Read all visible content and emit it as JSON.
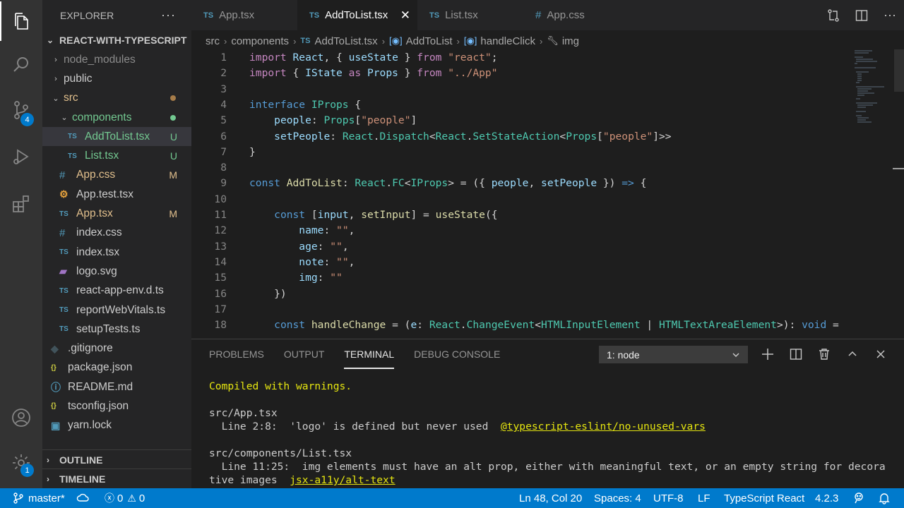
{
  "explorer": {
    "title": "EXPLORER",
    "project": "REACT-WITH-TYPESCRIPT",
    "tree": [
      {
        "label": "node_modules",
        "kind": "folder",
        "expanded": false,
        "depth": 1,
        "color": "#8b8b8b"
      },
      {
        "label": "public",
        "kind": "folder",
        "expanded": false,
        "depth": 1,
        "color": "#cccccc"
      },
      {
        "label": "src",
        "kind": "folder",
        "expanded": true,
        "depth": 1,
        "color": "#e2c08d",
        "dot": "#a67c49"
      },
      {
        "label": "components",
        "kind": "folder",
        "expanded": true,
        "depth": 2,
        "color": "#73c991",
        "dot": "#73c991"
      },
      {
        "label": "AddToList.tsx",
        "kind": "ts",
        "depth": 3,
        "color": "#73c991",
        "status": "U",
        "selected": true
      },
      {
        "label": "List.tsx",
        "kind": "ts",
        "depth": 3,
        "color": "#73c991",
        "status": "U"
      },
      {
        "label": "App.css",
        "kind": "css",
        "depth": 2,
        "color": "#e2c08d",
        "status": "M"
      },
      {
        "label": "App.test.tsx",
        "kind": "test",
        "depth": 2,
        "color": "#cccccc"
      },
      {
        "label": "App.tsx",
        "kind": "ts",
        "depth": 2,
        "color": "#e2c08d",
        "status": "M"
      },
      {
        "label": "index.css",
        "kind": "css",
        "depth": 2,
        "color": "#cccccc"
      },
      {
        "label": "index.tsx",
        "kind": "ts",
        "depth": 2,
        "color": "#cccccc"
      },
      {
        "label": "logo.svg",
        "kind": "svg",
        "depth": 2,
        "color": "#cccccc"
      },
      {
        "label": "react-app-env.d.ts",
        "kind": "ts",
        "depth": 2,
        "color": "#cccccc"
      },
      {
        "label": "reportWebVitals.ts",
        "kind": "ts",
        "depth": 2,
        "color": "#cccccc"
      },
      {
        "label": "setupTests.ts",
        "kind": "ts",
        "depth": 2,
        "color": "#cccccc"
      },
      {
        "label": ".gitignore",
        "kind": "git",
        "depth": 1,
        "color": "#cccccc"
      },
      {
        "label": "package.json",
        "kind": "json",
        "depth": 1,
        "color": "#cccccc"
      },
      {
        "label": "README.md",
        "kind": "info",
        "depth": 1,
        "color": "#cccccc"
      },
      {
        "label": "tsconfig.json",
        "kind": "json",
        "depth": 1,
        "color": "#cccccc"
      },
      {
        "label": "yarn.lock",
        "kind": "yarn",
        "depth": 1,
        "color": "#cccccc"
      }
    ],
    "outline": "OUTLINE",
    "timeline": "TIMELINE"
  },
  "activity": {
    "scm_badge": "4",
    "manage_badge": "1"
  },
  "tabs": [
    {
      "label": "App.tsx",
      "kind": "ts",
      "active": false
    },
    {
      "label": "AddToList.tsx",
      "kind": "ts",
      "active": true
    },
    {
      "label": "List.tsx",
      "kind": "ts",
      "active": false
    },
    {
      "label": "App.css",
      "kind": "css",
      "active": false
    }
  ],
  "breadcrumbs": {
    "a": "src",
    "b": "components",
    "c": "AddToList.tsx",
    "d": "AddToList",
    "e": "handleClick",
    "f": "img"
  },
  "code": [
    {
      "n": "1",
      "toks": [
        [
          "kc",
          "import"
        ],
        [
          "p",
          " "
        ],
        [
          "v",
          "React"
        ],
        [
          "p",
          ", { "
        ],
        [
          "v",
          "useState"
        ],
        [
          "p",
          " } "
        ],
        [
          "kc",
          "from"
        ],
        [
          "p",
          " "
        ],
        [
          "s",
          "\"react\""
        ],
        [
          "p",
          ";"
        ]
      ]
    },
    {
      "n": "2",
      "toks": [
        [
          "kc",
          "import"
        ],
        [
          "p",
          " { "
        ],
        [
          "v",
          "IState"
        ],
        [
          "p",
          " "
        ],
        [
          "kc",
          "as"
        ],
        [
          "p",
          " "
        ],
        [
          "v",
          "Props"
        ],
        [
          "p",
          " } "
        ],
        [
          "kc",
          "from"
        ],
        [
          "p",
          " "
        ],
        [
          "s",
          "\"../App\""
        ]
      ]
    },
    {
      "n": "3",
      "toks": []
    },
    {
      "n": "4",
      "toks": [
        [
          "k",
          "interface"
        ],
        [
          "p",
          " "
        ],
        [
          "t",
          "IProps"
        ],
        [
          "p",
          " {"
        ]
      ]
    },
    {
      "n": "5",
      "toks": [
        [
          "p",
          "    "
        ],
        [
          "v",
          "people"
        ],
        [
          "p",
          ": "
        ],
        [
          "t",
          "Props"
        ],
        [
          "p",
          "["
        ],
        [
          "s",
          "\"people\""
        ],
        [
          "p",
          "]"
        ]
      ]
    },
    {
      "n": "6",
      "toks": [
        [
          "p",
          "    "
        ],
        [
          "v",
          "setPeople"
        ],
        [
          "p",
          ": "
        ],
        [
          "t",
          "React"
        ],
        [
          "p",
          "."
        ],
        [
          "t",
          "Dispatch"
        ],
        [
          "p",
          "<"
        ],
        [
          "t",
          "React"
        ],
        [
          "p",
          "."
        ],
        [
          "t",
          "SetStateAction"
        ],
        [
          "p",
          "<"
        ],
        [
          "t",
          "Props"
        ],
        [
          "p",
          "["
        ],
        [
          "s",
          "\"people\""
        ],
        [
          "p",
          "]>>"
        ]
      ]
    },
    {
      "n": "7",
      "toks": [
        [
          "p",
          "}"
        ]
      ]
    },
    {
      "n": "8",
      "toks": []
    },
    {
      "n": "9",
      "toks": [
        [
          "k",
          "const"
        ],
        [
          "p",
          " "
        ],
        [
          "f",
          "AddToList"
        ],
        [
          "p",
          ": "
        ],
        [
          "t",
          "React"
        ],
        [
          "p",
          "."
        ],
        [
          "t",
          "FC"
        ],
        [
          "p",
          "<"
        ],
        [
          "t",
          "IProps"
        ],
        [
          "p",
          "> = ({ "
        ],
        [
          "v",
          "people"
        ],
        [
          "p",
          ", "
        ],
        [
          "v",
          "setPeople"
        ],
        [
          "p",
          " }) "
        ],
        [
          "k",
          "=>"
        ],
        [
          "p",
          " {"
        ]
      ]
    },
    {
      "n": "10",
      "toks": []
    },
    {
      "n": "11",
      "toks": [
        [
          "p",
          "    "
        ],
        [
          "k",
          "const"
        ],
        [
          "p",
          " ["
        ],
        [
          "v",
          "input"
        ],
        [
          "p",
          ", "
        ],
        [
          "f",
          "setInput"
        ],
        [
          "p",
          "] = "
        ],
        [
          "f",
          "useState"
        ],
        [
          "p",
          "({"
        ]
      ]
    },
    {
      "n": "12",
      "toks": [
        [
          "p",
          "        "
        ],
        [
          "v",
          "name"
        ],
        [
          "p",
          ": "
        ],
        [
          "s",
          "\"\""
        ],
        [
          "p",
          ","
        ]
      ]
    },
    {
      "n": "13",
      "toks": [
        [
          "p",
          "        "
        ],
        [
          "v",
          "age"
        ],
        [
          "p",
          ": "
        ],
        [
          "s",
          "\"\""
        ],
        [
          "p",
          ","
        ]
      ]
    },
    {
      "n": "14",
      "toks": [
        [
          "p",
          "        "
        ],
        [
          "v",
          "note"
        ],
        [
          "p",
          ": "
        ],
        [
          "s",
          "\"\""
        ],
        [
          "p",
          ","
        ]
      ]
    },
    {
      "n": "15",
      "toks": [
        [
          "p",
          "        "
        ],
        [
          "v",
          "img"
        ],
        [
          "p",
          ": "
        ],
        [
          "s",
          "\"\""
        ]
      ]
    },
    {
      "n": "16",
      "toks": [
        [
          "p",
          "    })"
        ]
      ]
    },
    {
      "n": "17",
      "toks": []
    },
    {
      "n": "18",
      "toks": [
        [
          "p",
          "    "
        ],
        [
          "k",
          "const"
        ],
        [
          "p",
          " "
        ],
        [
          "f",
          "handleChange"
        ],
        [
          "p",
          " = ("
        ],
        [
          "v",
          "e"
        ],
        [
          "p",
          ": "
        ],
        [
          "t",
          "React"
        ],
        [
          "p",
          "."
        ],
        [
          "t",
          "ChangeEvent"
        ],
        [
          "p",
          "<"
        ],
        [
          "t",
          "HTMLInputElement"
        ],
        [
          "p",
          " | "
        ],
        [
          "t",
          "HTMLTextAreaElement"
        ],
        [
          "p",
          ">): "
        ],
        [
          "k",
          "void"
        ],
        [
          "p",
          " ="
        ]
      ]
    }
  ],
  "panel": {
    "tabs": [
      "PROBLEMS",
      "OUTPUT",
      "TERMINAL",
      "DEBUG CONSOLE"
    ],
    "active_tab": "TERMINAL",
    "terminal_select": "1: node"
  },
  "terminal": {
    "l1": "Compiled with warnings.",
    "l2": "src/App.tsx",
    "l3a": "  Line 2:8:  'logo' is defined but never used  ",
    "l3b": "@typescript-eslint/no-unused-vars",
    "l4": "src/components/List.tsx",
    "l5": "  Line 11:25:  img elements must have an alt prop, either with meaningful text, or an empty string for decora",
    "l6a": "tive images  ",
    "l6b": "jsx-a11y/alt-text"
  },
  "status": {
    "branch": "master*",
    "errors": "0",
    "warnings": "0",
    "position": "Ln 48, Col 20",
    "spaces": "Spaces: 4",
    "encoding": "UTF-8",
    "eol": "LF",
    "language": "TypeScript React",
    "version": "4.2.3"
  }
}
